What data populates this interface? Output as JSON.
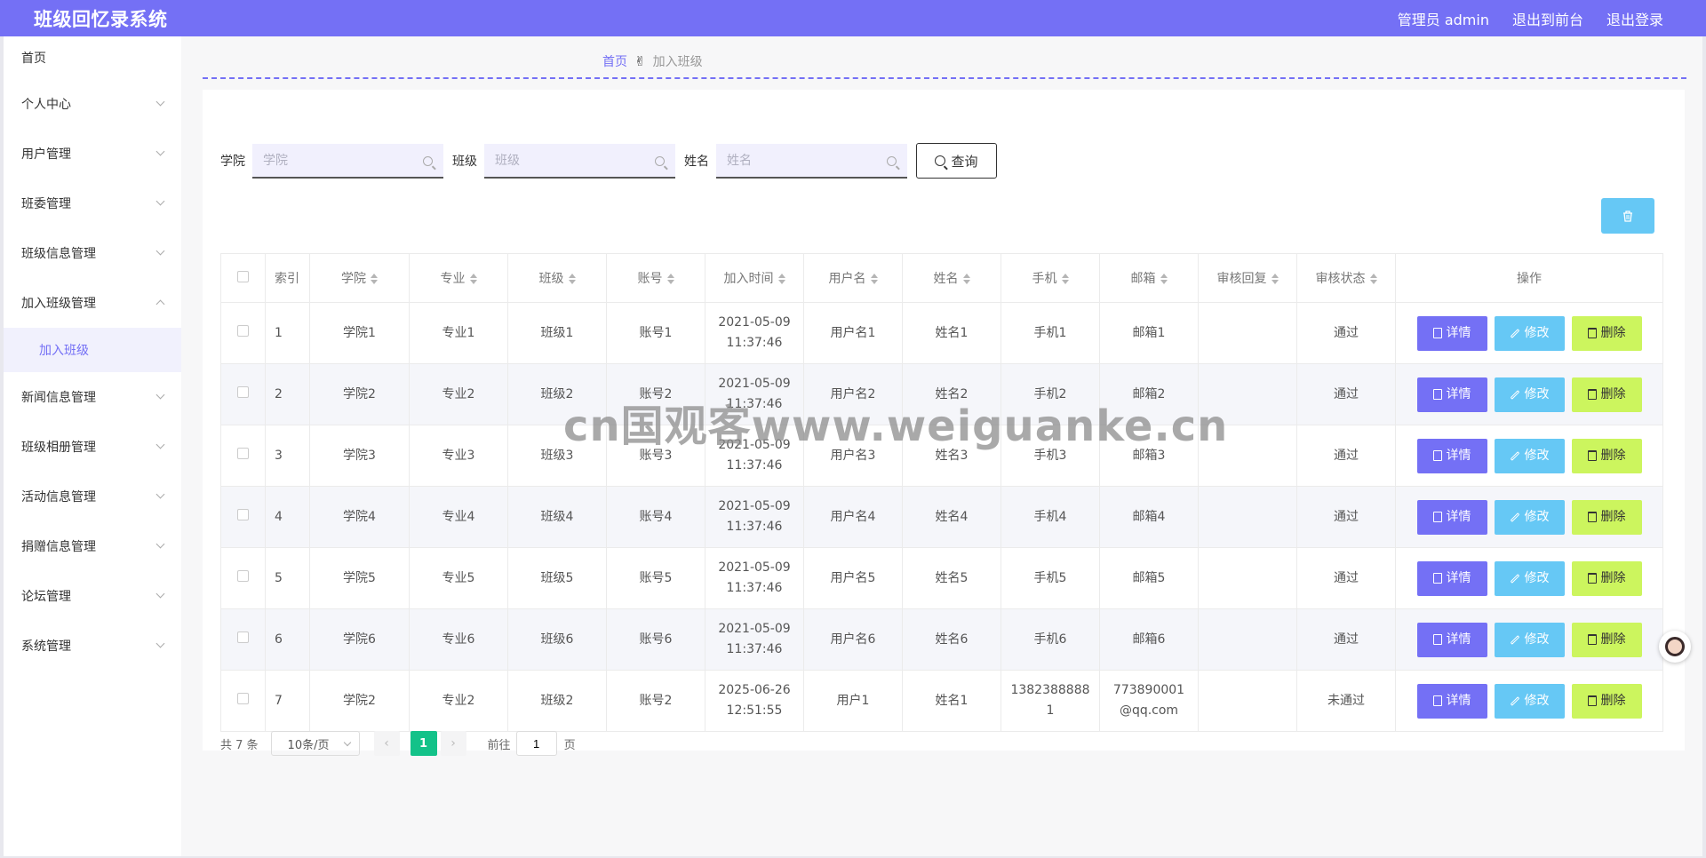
{
  "app": {
    "title": "班级回忆录系统"
  },
  "header": {
    "admin": "管理员 admin",
    "to_front": "退出到前台",
    "logout": "退出登录"
  },
  "sidebar": {
    "items": [
      {
        "label": "首页",
        "expandable": false
      },
      {
        "label": "个人中心",
        "expandable": true
      },
      {
        "label": "用户管理",
        "expandable": true
      },
      {
        "label": "班委管理",
        "expandable": true
      },
      {
        "label": "班级信息管理",
        "expandable": true
      },
      {
        "label": "加入班级管理",
        "expandable": true,
        "expanded": true
      },
      {
        "label": "新闻信息管理",
        "expandable": true
      },
      {
        "label": "班级相册管理",
        "expandable": true
      },
      {
        "label": "活动信息管理",
        "expandable": true
      },
      {
        "label": "捐赠信息管理",
        "expandable": true
      },
      {
        "label": "论坛管理",
        "expandable": true
      },
      {
        "label": "系统管理",
        "expandable": true
      }
    ],
    "sub_item": "加入班级"
  },
  "breadcrumb": {
    "home": "首页",
    "current": "加入班级"
  },
  "search": {
    "college_label": "学院",
    "college_placeholder": "学院",
    "class_label": "班级",
    "class_placeholder": "班级",
    "name_label": "姓名",
    "name_placeholder": "姓名",
    "button": "查询"
  },
  "table": {
    "headers": [
      "索引",
      "学院",
      "专业",
      "班级",
      "账号",
      "加入时间",
      "用户名",
      "姓名",
      "手机",
      "邮箱",
      "审核回复",
      "审核状态",
      "操作"
    ],
    "rows": [
      {
        "index": "1",
        "college": "学院1",
        "major": "专业1",
        "class": "班级1",
        "account": "账号1",
        "date": "2021-05-09",
        "time": "11:37:46",
        "username": "用户名1",
        "name": "姓名1",
        "phone": "手机1",
        "email": "邮箱1",
        "reply": "",
        "status": "通过"
      },
      {
        "index": "2",
        "college": "学院2",
        "major": "专业2",
        "class": "班级2",
        "account": "账号2",
        "date": "2021-05-09",
        "time": "11:37:46",
        "username": "用户名2",
        "name": "姓名2",
        "phone": "手机2",
        "email": "邮箱2",
        "reply": "",
        "status": "通过"
      },
      {
        "index": "3",
        "college": "学院3",
        "major": "专业3",
        "class": "班级3",
        "account": "账号3",
        "date": "2021-05-09",
        "time": "11:37:46",
        "username": "用户名3",
        "name": "姓名3",
        "phone": "手机3",
        "email": "邮箱3",
        "reply": "",
        "status": "通过"
      },
      {
        "index": "4",
        "college": "学院4",
        "major": "专业4",
        "class": "班级4",
        "account": "账号4",
        "date": "2021-05-09",
        "time": "11:37:46",
        "username": "用户名4",
        "name": "姓名4",
        "phone": "手机4",
        "email": "邮箱4",
        "reply": "",
        "status": "通过"
      },
      {
        "index": "5",
        "college": "学院5",
        "major": "专业5",
        "class": "班级5",
        "account": "账号5",
        "date": "2021-05-09",
        "time": "11:37:46",
        "username": "用户名5",
        "name": "姓名5",
        "phone": "手机5",
        "email": "邮箱5",
        "reply": "",
        "status": "通过"
      },
      {
        "index": "6",
        "college": "学院6",
        "major": "专业6",
        "class": "班级6",
        "account": "账号6",
        "date": "2021-05-09",
        "time": "11:37:46",
        "username": "用户名6",
        "name": "姓名6",
        "phone": "手机6",
        "email": "邮箱6",
        "reply": "",
        "status": "通过"
      },
      {
        "index": "7",
        "college": "学院2",
        "major": "专业2",
        "class": "班级2",
        "account": "账号2",
        "date": "2025-06-26",
        "time": "12:51:55",
        "username": "用户1",
        "name": "姓名1",
        "phone": "13823888881",
        "email": "773890001@qq.com",
        "reply": "",
        "status": "未通过"
      }
    ],
    "actions": {
      "detail": "详情",
      "edit": "修改",
      "delete": "删除"
    }
  },
  "pagination": {
    "total": "共 7 条",
    "page_size": "10条/页",
    "current_page": "1",
    "goto_label": "前往",
    "goto_value": "1",
    "page_suffix": "页"
  },
  "watermark": "cn国观客www.weiguanke.cn",
  "colors": {
    "primary": "#7470f5",
    "info": "#66c8f5",
    "lime": "#ccf55e",
    "pager_active": "#13c289"
  }
}
